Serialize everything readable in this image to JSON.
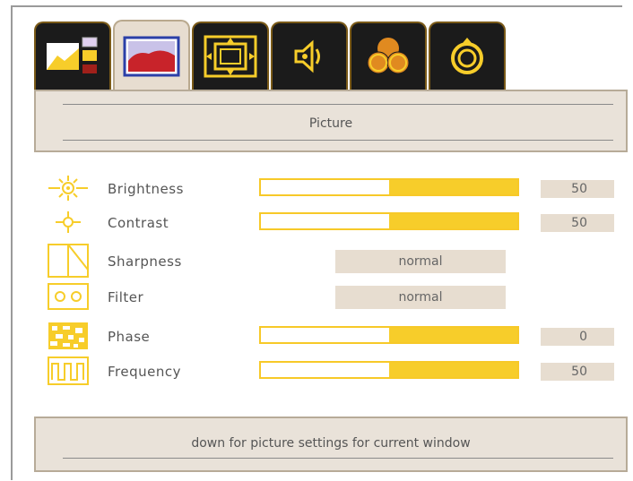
{
  "tabs": [
    {
      "icon": "input-select-icon",
      "active": false
    },
    {
      "icon": "picture-icon",
      "active": true
    },
    {
      "icon": "geometry-icon",
      "active": false
    },
    {
      "icon": "audio-icon",
      "active": false
    },
    {
      "icon": "color-icon",
      "active": false
    },
    {
      "icon": "setup-icon",
      "active": false
    }
  ],
  "header": {
    "title": "Picture"
  },
  "settings": {
    "brightness": {
      "label": "Brightness",
      "value": "50",
      "level": 0.5
    },
    "contrast": {
      "label": "Contrast",
      "value": "50",
      "level": 0.5
    },
    "sharpness": {
      "label": "Sharpness",
      "value": "normal"
    },
    "filter": {
      "label": "Filter",
      "value": "normal"
    },
    "phase": {
      "label": "Phase",
      "value": "0",
      "level": 0.5
    },
    "frequency": {
      "label": "Frequency",
      "value": "50",
      "level": 0.5
    }
  },
  "status": {
    "text": "down for picture settings for current window"
  },
  "colors": {
    "accent": "#f7cd2a",
    "panel": "#e9e2d9",
    "tab_bg": "#1b1b1b"
  }
}
